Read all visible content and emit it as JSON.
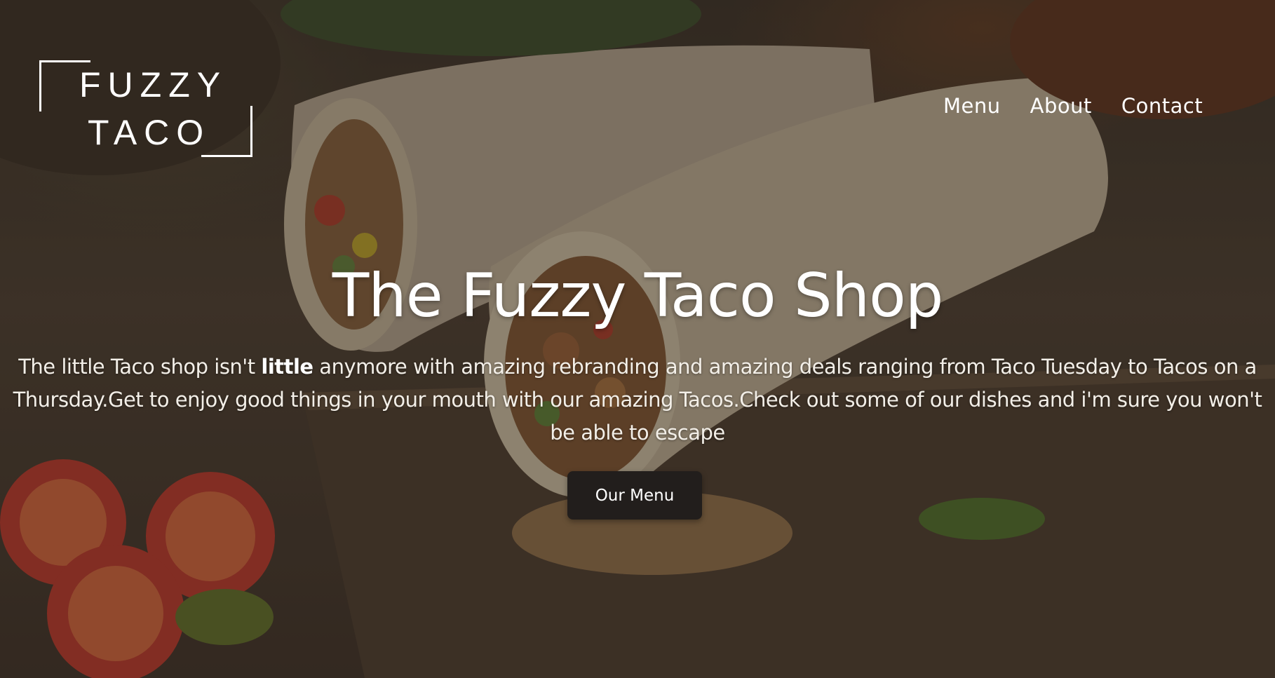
{
  "logo": {
    "line1": "FUZZY",
    "line2": "TACO"
  },
  "nav": {
    "items": [
      {
        "label": "Menu"
      },
      {
        "label": "About"
      },
      {
        "label": "Contact"
      }
    ]
  },
  "hero": {
    "title": "The Fuzzy Taco Shop",
    "description_part1": "The little Taco shop isn't ",
    "description_emphasis": "little",
    "description_part2": " anymore with amazing rebranding and amazing deals ranging from Taco Tuesday to Tacos on a Thursday.Get to enjoy good things in your mouth with our amazing Tacos.Check out some of our dishes and i'm sure you won't be able to escape",
    "cta_label": "Our Menu"
  },
  "colors": {
    "text": "#ffffff",
    "button_bg": "#221e1c",
    "overlay": "#1e1814"
  },
  "background_image": "burritos-on-wooden-board-photo"
}
